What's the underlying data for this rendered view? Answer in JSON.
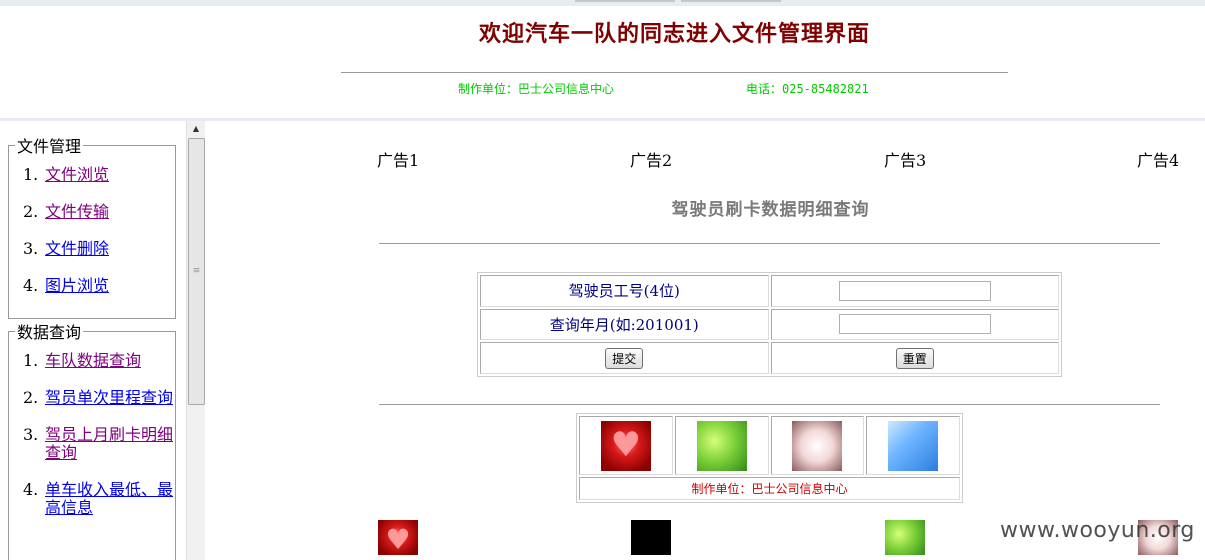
{
  "header": {
    "title": "欢迎汽车一队的同志进入文件管理界面",
    "maker": "制作单位：巴士公司信息中心",
    "phone": "电话：025-85482821"
  },
  "sidebar": {
    "groups": [
      {
        "legend": "文件管理",
        "items": [
          {
            "num": "1.",
            "label": "文件浏览"
          },
          {
            "num": "2.",
            "label": "文件传输"
          },
          {
            "num": "3.",
            "label": "文件删除"
          },
          {
            "num": "4.",
            "label": "图片浏览"
          }
        ]
      },
      {
        "legend": "数据查询",
        "items": [
          {
            "num": "1.",
            "label": "车队数据查询"
          },
          {
            "num": "2.",
            "label": "驾员单次里程查询"
          },
          {
            "num": "3.",
            "label": "驾员上月刷卡明细查询"
          },
          {
            "num": "4.",
            "label": "单车收入最低、最高信息"
          }
        ]
      }
    ]
  },
  "main": {
    "ads": [
      "广告1",
      "广告2",
      "广告3",
      "广告4"
    ],
    "section_title": "驾驶员刷卡数据明细查询",
    "form": {
      "driver_id_label": "驾驶员工号(4位)",
      "driver_id_value": "",
      "month_label": "查询年月(如:201001)",
      "month_value": "",
      "submit_label": "提交",
      "reset_label": "重置"
    },
    "thumbs": [
      "heart-image",
      "green-image",
      "pale-image",
      "blue-image"
    ],
    "thumbs_credit": "制作单位：巴士公司信息中心",
    "bottom_images": [
      "heart-image",
      "black-image",
      "green-image",
      "pale-image"
    ]
  },
  "watermark": "www.wooyun.org",
  "colors": {
    "title": "#800000",
    "header_credit": "#00cc00",
    "thumbs_credit": "#cc0000",
    "form_label": "#00007f",
    "section_title": "#7a7a7a",
    "visited_link": "#800080",
    "link": "#0000ee"
  }
}
